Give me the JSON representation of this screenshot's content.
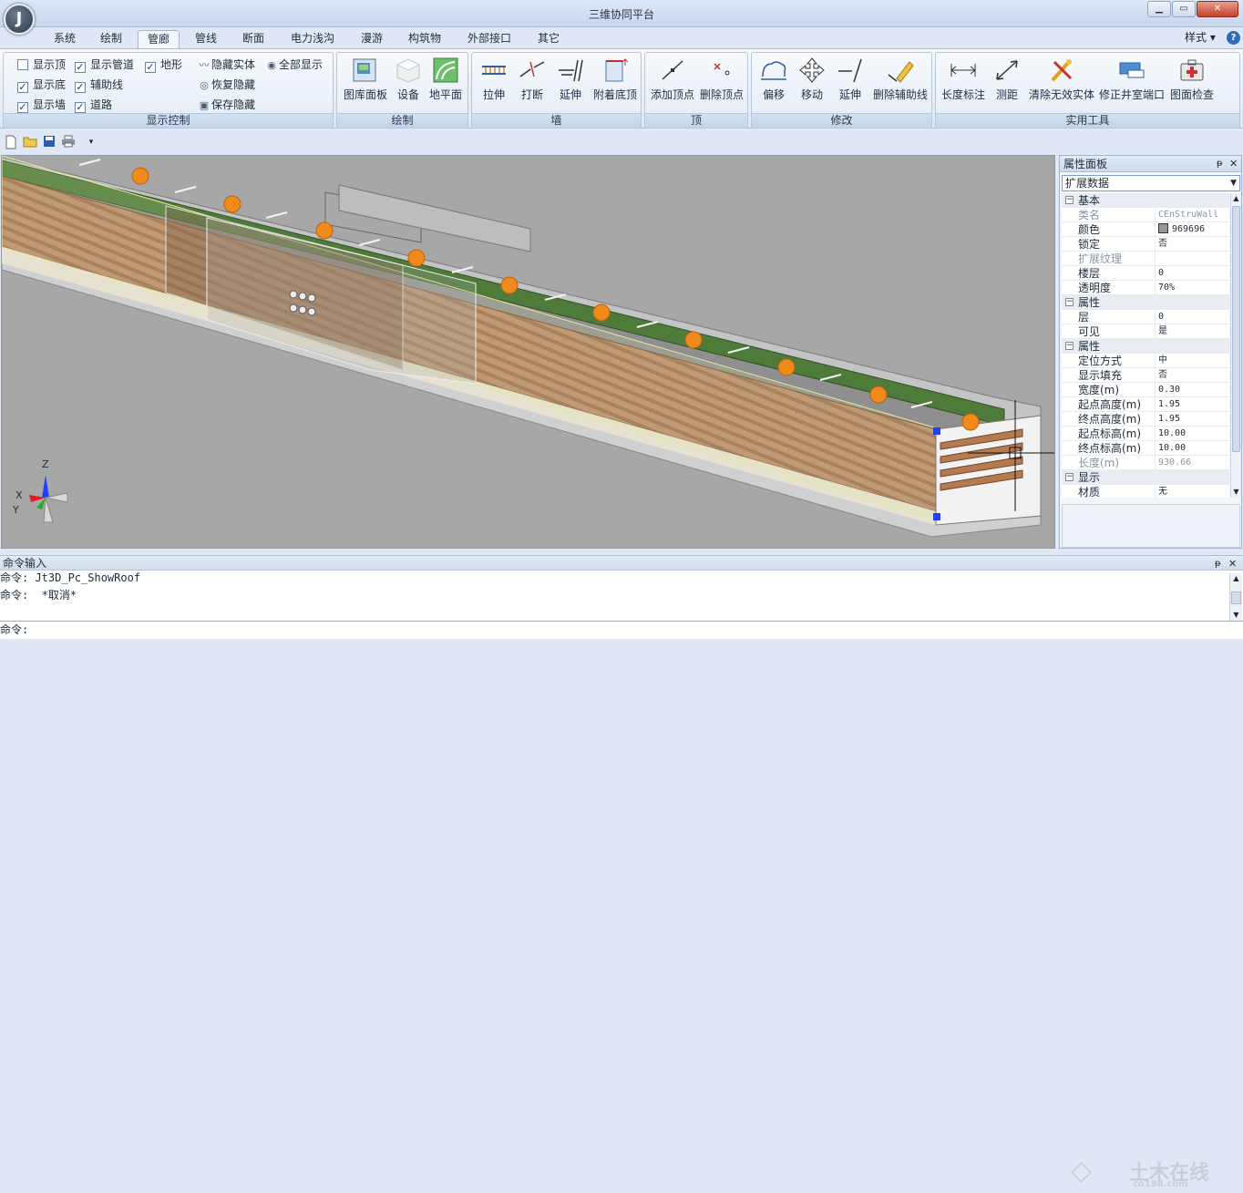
{
  "app": {
    "logo_letter": "J",
    "title": "三维协同平台"
  },
  "window_buttons": {
    "minimize": "▁",
    "maximize": "▭",
    "close": "✕"
  },
  "menu": {
    "tabs": [
      "系统",
      "绘制",
      "管廊",
      "管线",
      "断面",
      "电力浅沟",
      "漫游",
      "构筑物",
      "外部接口",
      "其它"
    ],
    "active_tab": "管廊",
    "style_label": "样式 ▾",
    "help": "?"
  },
  "ribbon": {
    "display_control": {
      "label": "显示控制",
      "checkboxes": [
        {
          "label": "显示顶",
          "checked": false
        },
        {
          "label": "显示管道",
          "checked": true
        },
        {
          "label": "地形",
          "checked": true
        },
        {
          "label": "显示底",
          "checked": true
        },
        {
          "label": "辅助线",
          "checked": true
        },
        {
          "label": "显示墙",
          "checked": true
        },
        {
          "label": "道路",
          "checked": true
        }
      ],
      "actions": [
        "隐藏实体",
        "全部显示",
        "恢复隐藏",
        "保存隐藏"
      ]
    },
    "draw": {
      "label": "绘制",
      "buttons": [
        "图库面板",
        "设备",
        "地平面"
      ]
    },
    "wall": {
      "label": "墙",
      "buttons": [
        "拉伸",
        "打断",
        "延伸",
        "附着底顶"
      ]
    },
    "top": {
      "label": "顶",
      "buttons": [
        "添加顶点",
        "删除顶点"
      ]
    },
    "modify": {
      "label": "修改",
      "buttons": [
        "偏移",
        "移动",
        "延伸",
        "删除辅助线"
      ]
    },
    "tools": {
      "label": "实用工具",
      "buttons": [
        "长度标注",
        "测距",
        "清除无效实体",
        "修正井室端口",
        "图面检查"
      ]
    }
  },
  "quick_access": [
    "new-file-icon",
    "open-folder-icon",
    "save-icon",
    "print-icon",
    "customize-arrow-icon"
  ],
  "axis": {
    "z": "Z",
    "x": "X",
    "y": "Y"
  },
  "properties": {
    "title": "属性面板",
    "pin": "ᵽ",
    "close": "✕",
    "combo": "扩展数据",
    "rows": [
      {
        "type": "cat",
        "name": "基本"
      },
      {
        "name": "类名",
        "value": "CEnStruWall",
        "disabled": true
      },
      {
        "name": "颜色",
        "value": "969696",
        "swatch": "#969696"
      },
      {
        "name": "锁定",
        "value": "否"
      },
      {
        "name": "扩展纹理",
        "value": "",
        "disabled": true
      },
      {
        "name": "楼层",
        "value": "0"
      },
      {
        "name": "透明度",
        "value": "70%"
      },
      {
        "type": "cat",
        "name": "属性"
      },
      {
        "name": "层",
        "value": "0"
      },
      {
        "name": "可见",
        "value": "是"
      },
      {
        "type": "cat",
        "name": "属性"
      },
      {
        "name": "定位方式",
        "value": "中"
      },
      {
        "name": "显示填充",
        "value": "否"
      },
      {
        "name": "宽度(m)",
        "value": "0.30"
      },
      {
        "name": "起点高度(m)",
        "value": "1.95"
      },
      {
        "name": "终点高度(m)",
        "value": "1.95"
      },
      {
        "name": "起点标高(m)",
        "value": "10.00"
      },
      {
        "name": "终点标高(m)",
        "value": "10.00"
      },
      {
        "name": "长度(m)",
        "value": "930.66",
        "disabled": true
      },
      {
        "type": "cat",
        "name": "显示"
      },
      {
        "name": "材质",
        "value": "无"
      }
    ]
  },
  "command": {
    "title": "命令输入",
    "lines": [
      "命令: Jt3D_Pc_ShowRoof",
      "命令:  *取消*"
    ],
    "prompt": "命令:"
  },
  "watermark": {
    "text": "土木在线",
    "sub": "co188.com"
  }
}
